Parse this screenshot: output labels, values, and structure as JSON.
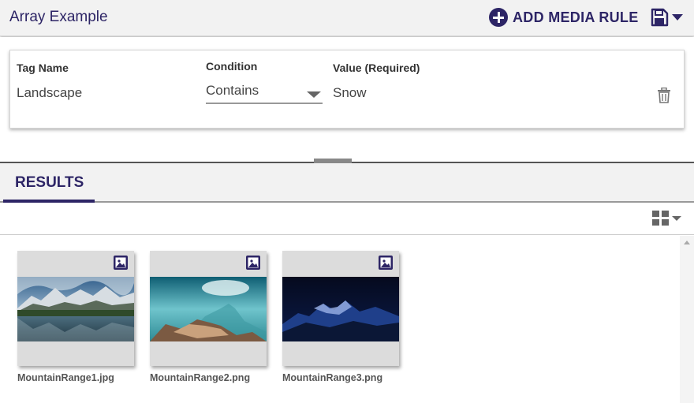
{
  "header": {
    "title": "Array Example",
    "add_rule_label": "ADD MEDIA RULE"
  },
  "rule": {
    "tag_name_label": "Tag Name",
    "tag_name_value": "Landscape",
    "condition_label": "Condition",
    "condition_value": "Contains",
    "value_label": "Value (Required)",
    "value_value": "Snow"
  },
  "tabs": [
    {
      "label": "RESULTS",
      "active": true
    }
  ],
  "results": [
    {
      "filename": "MountainRange1.jpg",
      "icon": "image-icon"
    },
    {
      "filename": "MountainRange2.png",
      "icon": "image-icon"
    },
    {
      "filename": "MountainRange3.png",
      "icon": "image-icon"
    }
  ],
  "colors": {
    "brand": "#2d2566",
    "header_bg": "#f2f2f2",
    "thumb_bg": "#dcdcdc"
  }
}
